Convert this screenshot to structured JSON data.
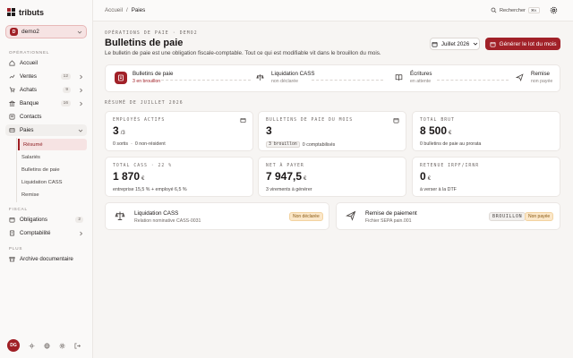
{
  "app": {
    "logo": "tributs"
  },
  "workspace": {
    "badge": "D",
    "name": "demo2"
  },
  "sidebar": {
    "sections": {
      "operational": "OPÉRATIONNEL",
      "fiscal": "FISCAL",
      "more": "PLUS"
    },
    "items": [
      {
        "label": "Accueil"
      },
      {
        "label": "Ventes",
        "count": "12"
      },
      {
        "label": "Achats",
        "count": "9"
      },
      {
        "label": "Banque",
        "count": "16"
      },
      {
        "label": "Contacts"
      },
      {
        "label": "Paies"
      }
    ],
    "paie_sub": [
      "Résumé",
      "Salariés",
      "Bulletins de paie",
      "Liquidation CASS",
      "Remise"
    ],
    "fiscal_items": [
      {
        "label": "Obligations",
        "count": "2"
      },
      {
        "label": "Comptabilité"
      }
    ],
    "more_items": [
      {
        "label": "Archive documentaire"
      }
    ],
    "user_initials": "DG"
  },
  "topbar": {
    "breadcrumb": [
      "Accueil",
      "/",
      "Paies"
    ],
    "search_label": "Rechercher",
    "search_shortcut": "⌘K"
  },
  "header": {
    "overline": "OPÉRATIONS DE PAIE · DEMO2",
    "title": "Bulletins de paie",
    "lead": "Le bulletin de paie est une obligation fiscale-comptable. Tout ce qui est modifiable vit dans le brouillon du mois.",
    "month": "Juillet 2026",
    "generate_button": "Générer le lot du mois"
  },
  "steps": [
    {
      "title": "Bulletins de paie",
      "status": "3 en brouillon",
      "icon": "document-icon"
    },
    {
      "title": "Liquidation CASS",
      "status": "non déclarée",
      "icon": "scale-icon"
    },
    {
      "title": "Écritures",
      "status": "en attente",
      "icon": "book-icon"
    },
    {
      "title": "Remise",
      "status": "non payée",
      "icon": "send-icon"
    }
  ],
  "summary": {
    "heading": "RÉSUMÉ DE JUILLET 2026",
    "cards": [
      {
        "label": "EMPLOYÉS ACTIFS",
        "value": "3",
        "unit": "/3",
        "sub1": "0 sortis",
        "sep": "·",
        "sub2": "0 non-résident"
      },
      {
        "label": "BULLETINS DE PAIE DU MOIS",
        "value": "3",
        "unit": "",
        "tag": "3 brouillon",
        "sub2": "0 comptabilisés"
      },
      {
        "label": "TOTAL BRUT",
        "value": "8 500",
        "unit": "€",
        "sub1": "0 bulletins de paie au prorata"
      },
      {
        "label": "TOTAL CASS · 22 %",
        "value": "1 870",
        "unit": "€",
        "sub1": "entreprise 15,5 % + employé 6,5 %"
      },
      {
        "label": "NET À PAYER",
        "value": "7 947,5",
        "unit": "€",
        "sub1": "3 virements à générer"
      },
      {
        "label": "RETENUE IRPF/IRNR",
        "value": "0",
        "unit": "€",
        "sub1": "à verser à la DTF"
      }
    ]
  },
  "bottom": [
    {
      "title": "Liquidation CASS",
      "sub": "Relation nominative CASS-0031",
      "status": "Non déclarée"
    },
    {
      "title": "Remise de paiement",
      "sub": "Fichier SEPA pain.001",
      "tag": "BROUILLON",
      "status": "Non payée"
    }
  ],
  "colors": {
    "accent": "#a12128",
    "accent_soft": "#f6e3e3",
    "warn": "#fbe7c9"
  }
}
